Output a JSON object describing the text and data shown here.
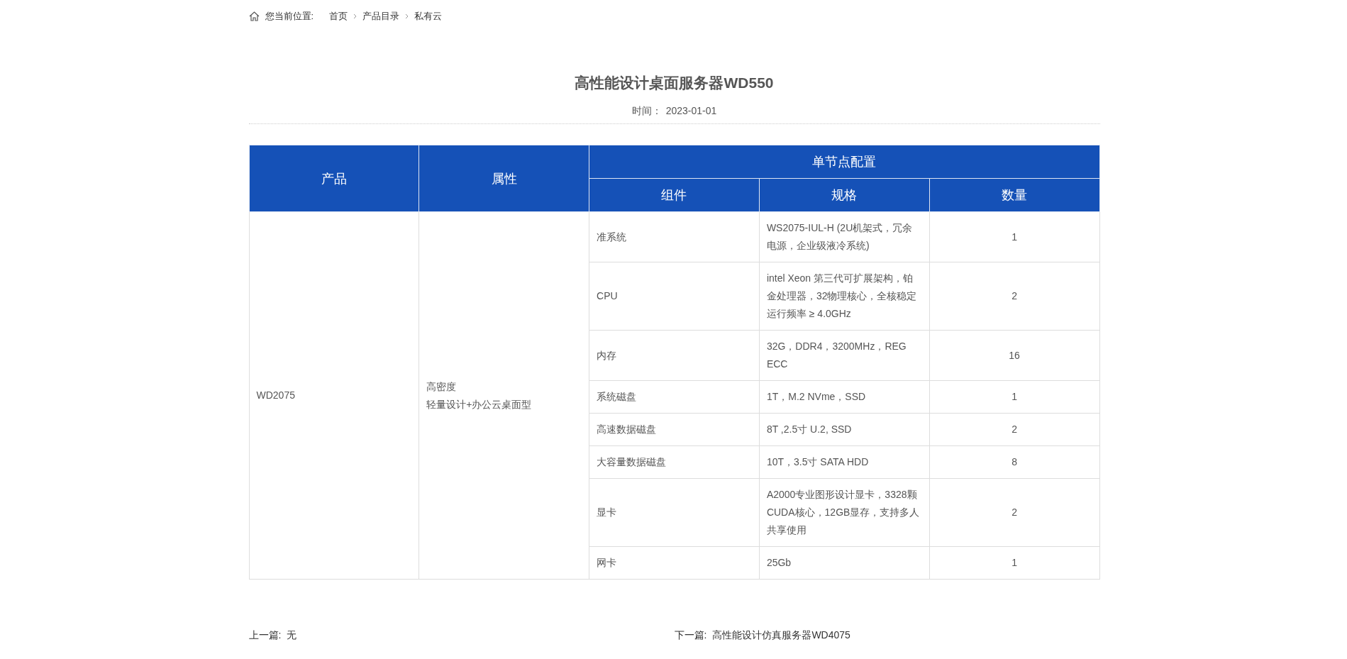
{
  "breadcrumb": {
    "label": "您当前位置:",
    "items": [
      "首页",
      "产品目录",
      "私有云"
    ]
  },
  "title": "高性能设计桌面服务器WD550",
  "date": {
    "label": "时间：",
    "value": "2023-01-01"
  },
  "table": {
    "head": {
      "product": "产品",
      "attribute": "属性",
      "group": "单节点配置",
      "columns": [
        "组件",
        "规格",
        "数量"
      ]
    },
    "product": "WD2075",
    "attribute": [
      "高密度",
      "轻量设计+办公云桌面型"
    ],
    "rows": [
      {
        "component": "准系统",
        "spec": "WS2075-IUL-H (2U机架式，冗余电源，企业级液冷系统)",
        "quantity": "1"
      },
      {
        "component": "CPU",
        "spec": "intel Xeon 第三代可扩展架构，铂金处理器，32物理核心，全核稳定运行频率 ≥ 4.0GHz",
        "quantity": "2"
      },
      {
        "component": "内存",
        "spec": "32G，DDR4，3200MHz，REG ECC",
        "quantity": "16"
      },
      {
        "component": "系统磁盘",
        "spec": "1T，M.2 NVme，SSD",
        "quantity": "1"
      },
      {
        "component": "高速数据磁盘",
        "spec": "8T ,2.5寸 U.2, SSD",
        "quantity": "2"
      },
      {
        "component": "大容量数据磁盘",
        "spec": "10T，3.5寸 SATA HDD",
        "quantity": "8"
      },
      {
        "component": "显卡",
        "spec": "A2000专业图形设计显卡，3328颗CUDA核心，12GB显存，支持多人共享使用",
        "quantity": "2"
      },
      {
        "component": "网卡",
        "spec": "25Gb",
        "quantity": "1"
      }
    ]
  },
  "pager": {
    "previous": {
      "label": "上一篇:",
      "value": "无"
    },
    "next": {
      "label": "下一篇:",
      "value": "高性能设计仿真服务器WD4075"
    }
  }
}
